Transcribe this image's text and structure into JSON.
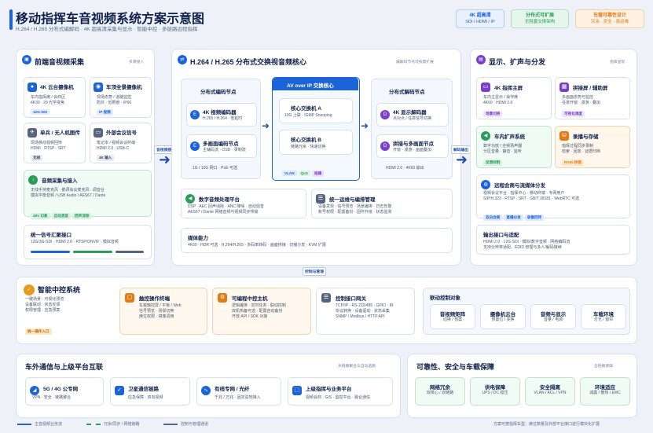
{
  "header": {
    "title": "移动指挥车音视频系统方案示意图",
    "subtitle": "H.264 / H.265 分布式编解码 · 4K 超高清采集与显示 · 智能中控 · 多链路远程指挥",
    "tags": [
      {
        "title": "4K 超高清",
        "sub": "SDI / HDMI / IP",
        "color": "#1d63d8"
      },
      {
        "title": "分布式可扩展",
        "sub": "无阻塞交换架构",
        "color": "#2a9d5c"
      },
      {
        "title": "车载可靠性设计",
        "sub": "冗余 · 安全 · 易运维",
        "color": "#e07b16"
      }
    ]
  },
  "front": {
    "title": "前端音视频采集",
    "note": "多源接入",
    "items": [
      {
        "title": "4K 云台摄像机",
        "desc": "车内指挥席 / 会商区|4K30 · 20 光学变焦",
        "pill": "12G-SDI"
      },
      {
        "title": "车顶全景摄像机",
        "desc": "现场态势 / 道路监控|防抖 · 低照度 · IP66",
        "pill": "IP 视频"
      },
      {
        "title": "单兵 / 无人机图传",
        "desc": "现场移动视频回传|HDMI · RTSP · SRT",
        "pill": "无线"
      },
      {
        "title": "外部会议信号",
        "desc": "笔记本 / 视频会议终端|HDMI 2.0 · USB-C",
        "pill": "4K 输入"
      }
    ],
    "audio": {
      "title": "音频采集与接入",
      "desc": "无线手持麦克风 · 鹅颈会议麦克风 · 调音台|模拟平衡音频 / USB Audio / AES67 / Dante",
      "pills": [
        "48V 幻象",
        "自动混音",
        "回声消除"
      ]
    },
    "unify": {
      "title": "统一信号汇聚接口",
      "desc": "12G/3G-SDI · HDMI 2.0 · RTSP/ONVIF · 模拟音频"
    }
  },
  "core": {
    "title": "H.264 / H.265 分布式交换视音频核心",
    "note": "编解码节点可按需扩展",
    "enc_title": "分布式编码节点",
    "enc": [
      {
        "tag": "E",
        "title": "4K 视频编码器",
        "desc": "H.265 / H.264 · 低延时"
      },
      {
        "tag": "E",
        "title": "多画面编码节点",
        "desc": "主辅码流 · OSD · 录制流"
      }
    ],
    "enc_foot": "1G / 10G 网口 · PoE 可选",
    "av_title": "AV over IP 交换核心",
    "switch": [
      {
        "title": "核心交换机 A",
        "desc": "10G 上联 · IGMP Snooping"
      },
      {
        "title": "核心交换机 B",
        "desc": "链路冗余 · 快速切换"
      }
    ],
    "net_pills": [
      "VLAN",
      "QoS",
      "组播"
    ],
    "dec_title": "分布式解码节点",
    "dec": [
      {
        "tag": "D",
        "title": "4K 显示解码器",
        "desc": "点对点 / 任意信号切换"
      },
      {
        "tag": "D",
        "title": "拼接与多画面节点",
        "desc": "开窗 · 漫游 · 画面叠加"
      }
    ],
    "dec_foot": "HDMI 2.0 · 4K60 输出",
    "dsp": {
      "title": "数字音频处理平台",
      "desc": "DSP · AEC 回声消除 · ANC 降噪 · 自动混音|AES67 / Dante 网络音频与视频同步传输"
    },
    "ops": {
      "title": "统一运维与编排管理",
      "desc": "设备发现 · 信号预览 · 场景编排 · 日志告警|账号权限 · 配置备份 · 固件升级 · 状态监测"
    },
    "media": {
      "title": "媒体能力",
      "desc": "4K60 · HDR 可选 · H.264/H.265 · 多码率转码 · 画面拼接 · 切播分发 · KVM 扩展"
    },
    "in_label": "音视频接入",
    "out_label": "解码输出",
    "ctrl_label": "控制与管理"
  },
  "display": {
    "title": "显示、扩声与分发",
    "note": "指挥呈现",
    "items": [
      {
        "title": "4K 指挥主屏",
        "desc": "车内主显示 / 操作席|4K60 · HDMI 2.0",
        "pill": "场景切换"
      },
      {
        "title": "拼接屏 / 辅助屏",
        "desc": "多画面态势与监控|任意开窗 · 漫游 · 叠加",
        "pill": "可视化调度"
      },
      {
        "title": "车内扩声系统",
        "desc": "数字功放 / 全频扬声器|分区音量 · 静音 · 监听",
        "pill": "反馈抑制"
      },
      {
        "title": "录播与存储",
        "desc": "指挥过程同步录制|检索 · 回放 · 证据归档",
        "pill": "RAID 存储"
      }
    ],
    "remote": {
      "title": "远程会商与流媒体分发",
      "desc": "视频会议平台 · 指挥中心 · 移动终端 · 专网用户|SIP/H.323 · RTSP · SRT · GB/T 28181 · WebRTC 可选",
      "pills": [
        "双向会商",
        "直播分发",
        "录像回传"
      ]
    },
    "output": {
      "title": "输出接口与适配",
      "desc": "HDMI 2.0 · 12G-SDI · 模拟/数字音频 · 网络编码流|支持分辨率适配、EDID 管理与多人/解码接续"
    }
  },
  "control": {
    "title": "智能中控系统",
    "desc": "一键场景 · 可视化预览|设备联动 · 状态反馈|权限管理 · 应急预案",
    "pill": "统一操作入口",
    "items": [
      {
        "title": "触控操作终端",
        "desc": "车载触控屏 / 平板 / Web|信号预览 · 场景切换|席位权限 · 镜像调用"
      },
      {
        "title": "可编程中控主机",
        "desc": "逻辑编排 · 定时任务 · 联动控制|双机热备可选 · 配置自动备份|开放 API / SDK 对接"
      },
      {
        "title": "控制接口网关",
        "desc": "TCP/IP · RS-232/485 · GPIO · IR|协议转换 · 设备驱动 · 状态采集|SNMP / Modbus / HTTP API"
      }
    ],
    "linked_title": "联动控制对象",
    "linked": [
      {
        "title": "音视频矩阵",
        "desc": "切换 / 预案"
      },
      {
        "title": "摄像机云台",
        "desc": "预置位 / 变焦"
      },
      {
        "title": "音频与显示",
        "desc": "音量 / 电源"
      },
      {
        "title": "车载环境",
        "desc": "灯光 / 窗帘"
      }
    ]
  },
  "comm": {
    "title": "车外通信与上级平台互联",
    "note": "多链路聚合与自动选路",
    "items": [
      {
        "title": "5G / 4G 公专网",
        "desc": "VPN · 安全 · 链路聚合"
      },
      {
        "title": "卫星通信链路",
        "desc": "应急保障 · 双向视频"
      },
      {
        "title": "有线专网 / 光纤",
        "desc": "千兆 / 万兆 · 固定驻地接入"
      },
      {
        "title": "上级指挥与业务平台",
        "desc": "视频会商 · GIS · 监控平台 · 融合通信"
      }
    ]
  },
  "reliability": {
    "title": "可靠性、安全与车载保障",
    "note": "全链路保障",
    "items": [
      {
        "title": "网络冗余",
        "desc": "双核心 / 双链路"
      },
      {
        "title": "供电保障",
        "desc": "UPS / DC 稳压"
      },
      {
        "title": "安全隔离",
        "desc": "VLAN / ACL / VPN"
      },
      {
        "title": "环境适应",
        "desc": "减震 / 散热 / EMC"
      }
    ]
  },
  "legend": {
    "items": [
      "主音视频业务流",
      "冗余/同步 / 网络链路",
      "控制与管理通道"
    ],
    "footer": "方案可按指挥车型、席位数量及外部平台接口进行模块化扩展"
  },
  "colors": {
    "primary": "#1d63d8",
    "green": "#2a9d5c",
    "orange": "#e07b16",
    "purple": "#7b3fc9",
    "teal": "#1b9aa6"
  }
}
